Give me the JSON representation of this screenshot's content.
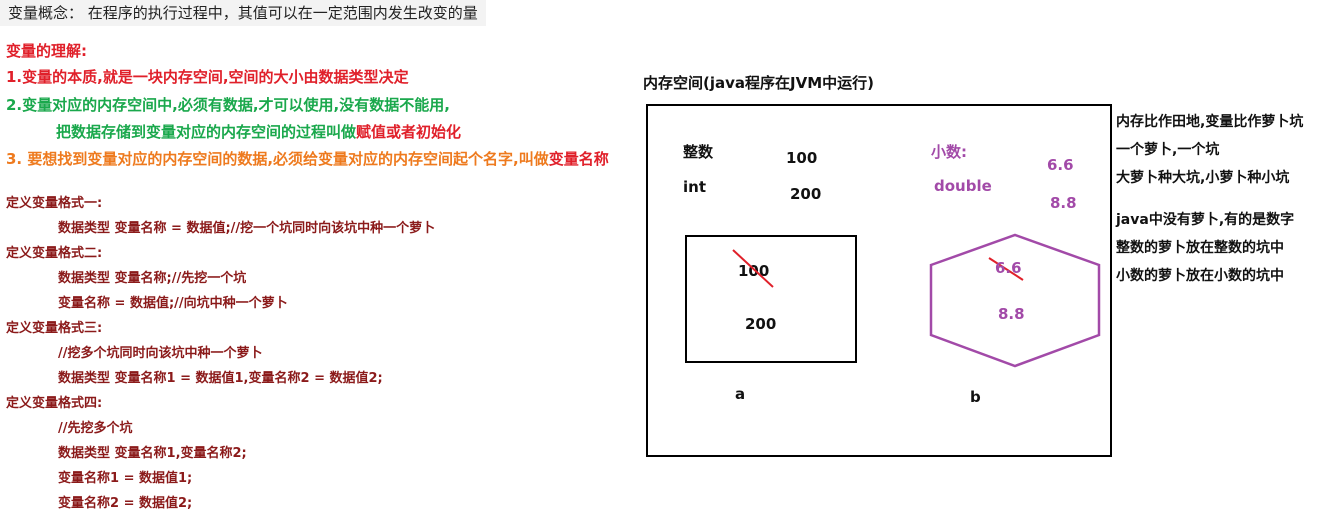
{
  "header": {
    "concept": "变量概念：  在程序的执行过程中，其值可以在一定范围内发生改变的量"
  },
  "understanding": {
    "title": "变量的理解:",
    "point1_a": "1.变量的本质,就是一块内存空间,空间的大小由",
    "point1_b": "数据类型",
    "point1_c": "决定",
    "point2_a": "2.变量对应的内存空间中,必须有数据,才可以使用,没有数据不能用,",
    "point2_b": "把数据存储到变量对应的内存空间的过程叫做",
    "point2_c": "赋值或者初始化",
    "point3_a": "3. 要想找到变量对应的内存空间的数据,必须给变量对应的内存空间起个名字,叫做",
    "point3_b": "变量名称"
  },
  "formats": [
    {
      "title": "定义变量格式一:",
      "lines": [
        "数据类型 变量名称 = 数据值;//挖一个坑同时向该坑中种一个萝卜"
      ]
    },
    {
      "title": "定义变量格式二:",
      "lines": [
        "数据类型 变量名称;//先挖一个坑",
        "变量名称 = 数据值;//向坑中种一个萝卜"
      ]
    },
    {
      "title": "定义变量格式三:",
      "lines": [
        "//挖多个坑同时向该坑中种一个萝卜",
        "数据类型 变量名称1 = 数据值1,变量名称2 = 数据值2;"
      ]
    },
    {
      "title": "定义变量格式四:",
      "lines": [
        "//先挖多个坑",
        "数据类型 变量名称1,变量名称2;",
        "变量名称1 = 数据值1;",
        "变量名称2 = 数据值2;"
      ]
    }
  ],
  "diagram": {
    "memory_title": "内存空间(java程序在JVM中运行)",
    "int_label_cn": "整数",
    "int_label": "int",
    "int_val1": "100",
    "int_val2": "200",
    "dec_label_cn": "小数:",
    "dec_label": "double",
    "dec_val1": "6.6",
    "dec_val2": "8.8",
    "box_a_old": "100",
    "box_a_new": "200",
    "box_a_name": "a",
    "box_b_old": "6.6",
    "box_b_new": "8.8",
    "box_b_name": "b"
  },
  "notes": {
    "line1": "内存比作田地,变量比作萝卜坑",
    "line2": "一个萝卜,一个坑",
    "line3": "大萝卜种大坑,小萝卜种小坑",
    "line4": "java中没有萝卜,有的是数字",
    "line5": "整数的萝卜放在整数的坑中",
    "line6": "小数的萝卜放在小数的坑中"
  },
  "colors": {
    "red": "#e0202a",
    "green": "#1aa84c",
    "orange": "#ee7a1e",
    "dark_red": "#8b1a1a",
    "purple": "#a24aa8"
  }
}
